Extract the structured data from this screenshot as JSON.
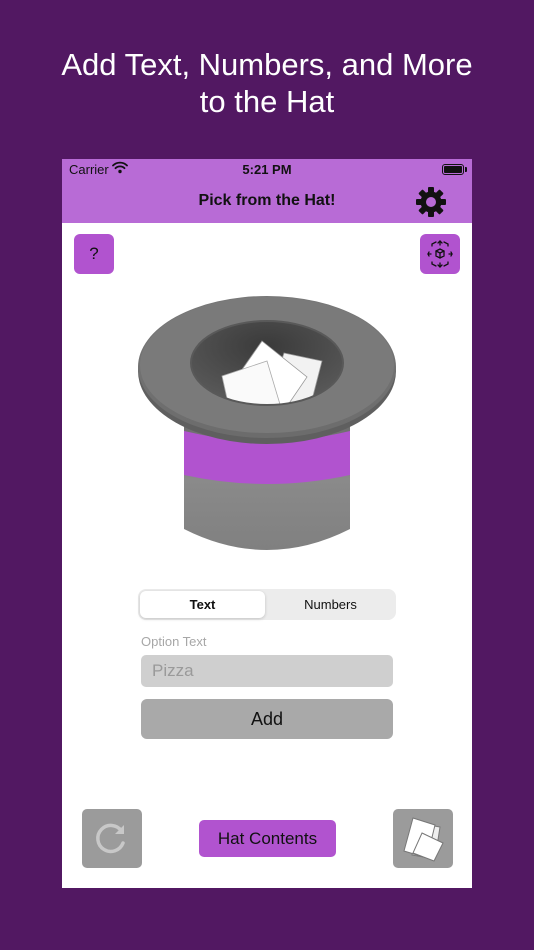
{
  "headline": {
    "line1": "Add Text, Numbers, and More",
    "line2": "to the Hat"
  },
  "status_bar": {
    "carrier": "Carrier",
    "time": "5:21 PM"
  },
  "nav": {
    "title": "Pick from the Hat!"
  },
  "buttons": {
    "help_label": "?",
    "add_label": "Add",
    "hat_contents_label": "Hat Contents"
  },
  "segmented_control": {
    "options": [
      "Text",
      "Numbers"
    ],
    "selected": "Text"
  },
  "input": {
    "label": "Option Text",
    "placeholder": "Pizza",
    "value": ""
  },
  "icons": {
    "settings": "gear-icon",
    "ar": "ar-cube-icon",
    "reset": "refresh-icon",
    "papers": "papers-icon",
    "wifi": "wifi-icon",
    "battery": "battery-icon"
  },
  "colors": {
    "background": "#521862",
    "nav_bar": "#b86bd6",
    "accent": "#b153cf",
    "hat_band": "#b153cf",
    "hat_body": "#808080",
    "button_gray": "#a9a9a9"
  }
}
